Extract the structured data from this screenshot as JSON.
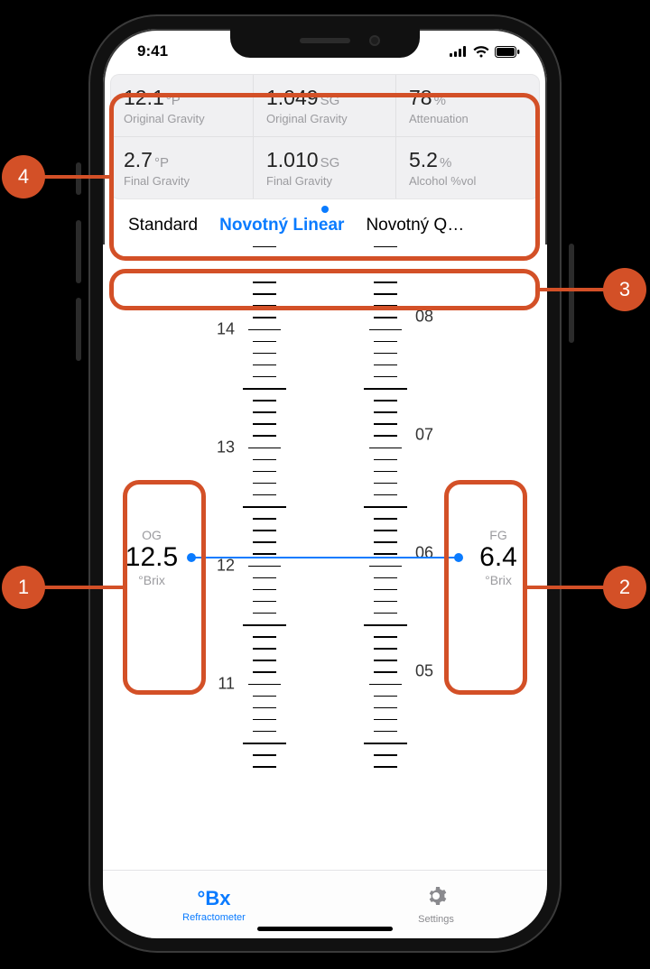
{
  "status": {
    "time": "9:41"
  },
  "stats": {
    "r1": [
      {
        "value": "12.1",
        "unit": "°P",
        "label": "Original Gravity"
      },
      {
        "value": "1.049",
        "unit": "SG",
        "label": "Original Gravity"
      },
      {
        "value": "78",
        "unit": "%",
        "label": "Attenuation"
      }
    ],
    "r2": [
      {
        "value": "2.7",
        "unit": "°P",
        "label": "Final Gravity"
      },
      {
        "value": "1.010",
        "unit": "SG",
        "label": "Final Gravity"
      },
      {
        "value": "5.2",
        "unit": "%",
        "label": "Alcohol %vol"
      }
    ]
  },
  "formulas": {
    "options": [
      "Standard",
      "Novotný Linear",
      "Novotný Q…"
    ],
    "active_index": 1
  },
  "scale": {
    "left": {
      "labels": [
        "14",
        "13",
        "12",
        "11"
      ]
    },
    "right": {
      "labels": [
        "08",
        "07",
        "06",
        "05"
      ]
    }
  },
  "reading": {
    "og": {
      "tag": "OG",
      "value": "12.5",
      "unit": "°Brix"
    },
    "fg": {
      "tag": "FG",
      "value": "6.4",
      "unit": "°Brix"
    }
  },
  "tabs": {
    "left": {
      "icon": "°Bx",
      "label": "Refractometer"
    },
    "right": {
      "label": "Settings"
    }
  },
  "annotations": {
    "n1": "1",
    "n2": "2",
    "n3": "3",
    "n4": "4"
  }
}
